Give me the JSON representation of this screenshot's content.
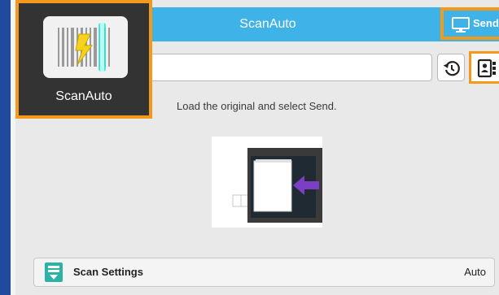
{
  "header": {
    "title": "ScanAuto"
  },
  "send_button": {
    "label": "Send",
    "icon": "monitor-icon"
  },
  "app_tile": {
    "label": "ScanAuto",
    "icon": "scan-auto-icon"
  },
  "address_bar": {
    "value": ""
  },
  "toolbar": {
    "history_icon": "history-icon",
    "addressbook_icon": "address-book-icon"
  },
  "main": {
    "instruction": "Load the original and select Send."
  },
  "scan_settings": {
    "label": "Scan Settings",
    "value": "Auto",
    "icon": "scan-settings-icon"
  },
  "colors": {
    "header": "#3fb3e8",
    "highlight": "#f39a1d",
    "tile": "#333333",
    "arrow": "#7a3fc2",
    "left_strip": "#1f4aa0"
  }
}
